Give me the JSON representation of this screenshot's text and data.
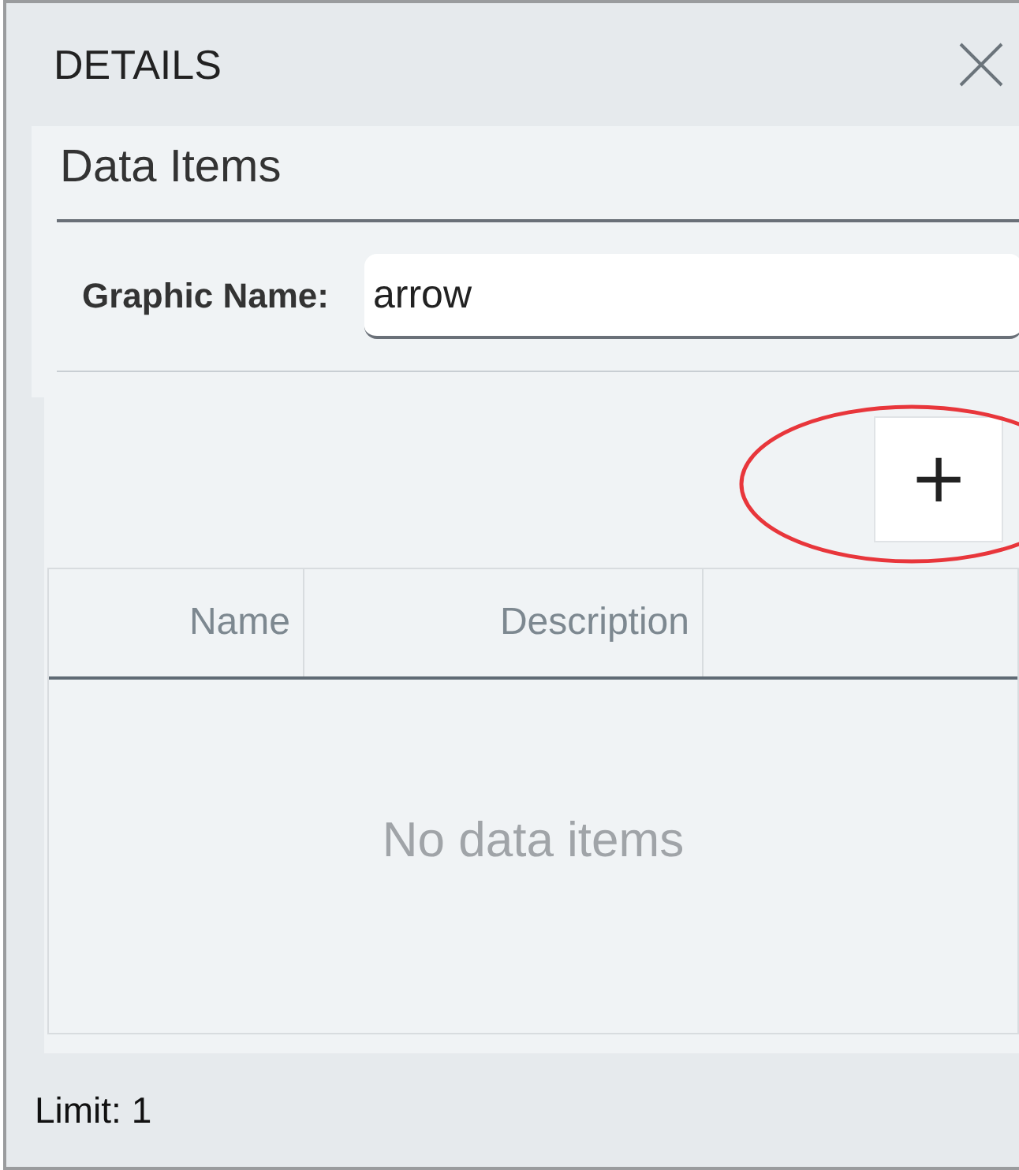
{
  "panel": {
    "title": "DETAILS"
  },
  "section": {
    "title": "Data Items"
  },
  "graphic_name": {
    "label": "Graphic Name:",
    "value": "arrow"
  },
  "add_button": {
    "label": "+",
    "highlighted": true
  },
  "table": {
    "columns": [
      "Name",
      "Description"
    ],
    "empty_message": "No data items"
  },
  "footer": {
    "limit": "Limit: 1"
  }
}
